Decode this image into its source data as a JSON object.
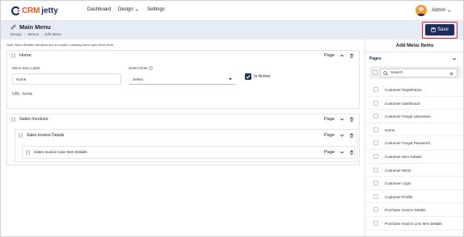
{
  "brand": {
    "part1": "CRM",
    "part2": "jetty"
  },
  "nav": [
    {
      "label": "Dashboard",
      "has_menu": false
    },
    {
      "label": "Design",
      "has_menu": true
    },
    {
      "label": "Settings",
      "has_menu": false
    }
  ],
  "user": {
    "label": "Admin"
  },
  "page": {
    "title": "Main Menu",
    "breadcrumbs": [
      "Design",
      "Menus",
      "Edit Menu"
    ],
    "save_label": "Save"
  },
  "note": "Note: Menu Builder will allow you to create a nesting menu upto three level.",
  "menu": {
    "home": {
      "name": "Home",
      "type": "Page",
      "label_caption": "Menu Item Label",
      "label_value": "Home",
      "role_caption": "Select Role",
      "role_value": "Select",
      "active_caption": "Is Active",
      "url": "URL: home"
    },
    "items": [
      {
        "name": "Sales Invoices",
        "type": "Page"
      },
      {
        "name": "Sales Invoice Details",
        "type": "Page"
      },
      {
        "name": "Sales Invoice Line Item Details",
        "type": "Page"
      }
    ]
  },
  "right_panel": {
    "title": "Add Menu Items",
    "section": "Pages",
    "search_placeholder": "Search",
    "pages": [
      "Customer Registration",
      "Customer Dashboard",
      "Customer Forgot Username",
      "Home",
      "Customer Forgot Password",
      "Customer Item Details",
      "Customer Items",
      "Customer Login",
      "Customer Profile",
      "Purchase Invoice Details",
      "Purchase Invoice Line Item Details"
    ]
  },
  "colors": {
    "brand_navy": "#1e2d5a",
    "brand_orange": "#e8541e",
    "highlight_red": "#e02828"
  }
}
